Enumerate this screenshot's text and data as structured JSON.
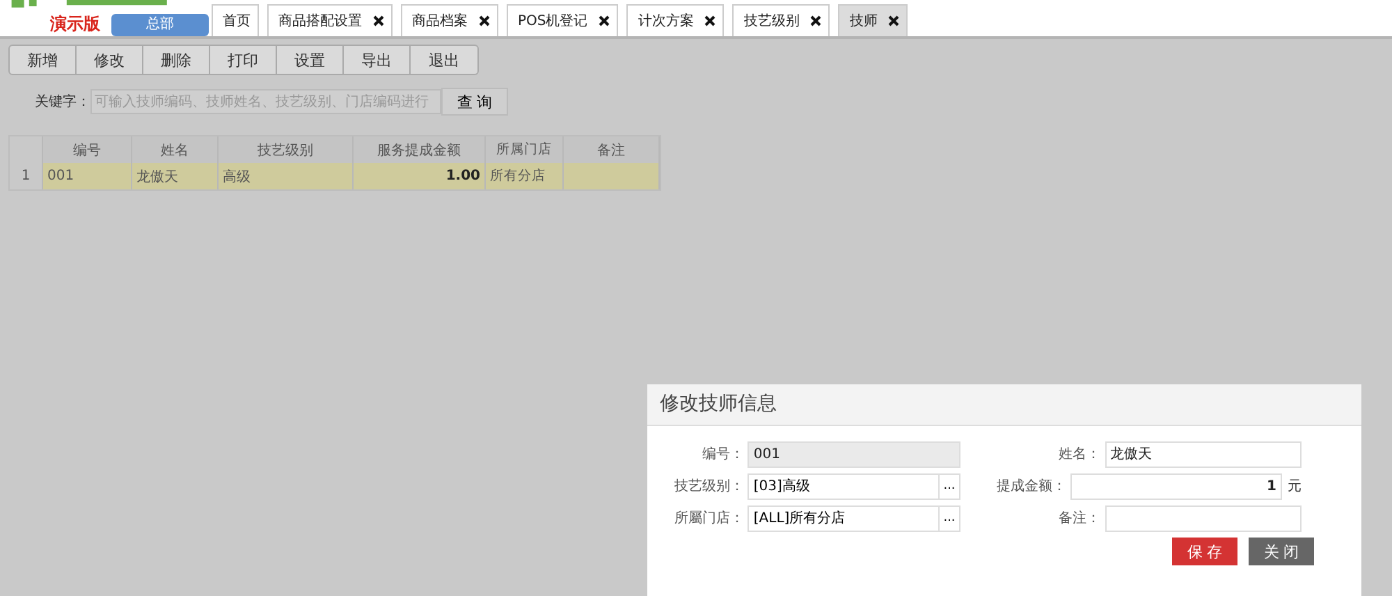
{
  "header": {
    "edition": "演示版",
    "branch": "总部"
  },
  "tabs": [
    {
      "label": "首页",
      "closable": false,
      "selected": false
    },
    {
      "label": "商品搭配设置",
      "closable": true,
      "selected": false
    },
    {
      "label": "商品档案",
      "closable": true,
      "selected": false
    },
    {
      "label": "POS机登记",
      "closable": true,
      "selected": false
    },
    {
      "label": "计次方案",
      "closable": true,
      "selected": false
    },
    {
      "label": "技艺级别",
      "closable": true,
      "selected": false
    },
    {
      "label": "技师",
      "closable": true,
      "selected": true
    }
  ],
  "toolbar": [
    "新增",
    "修改",
    "删除",
    "打印",
    "设置",
    "导出",
    "退出"
  ],
  "search": {
    "label": "关键字：",
    "placeholder": "可输入技师编码、技师姓名、技艺级别、门店编码进行",
    "button": "查 询"
  },
  "table": {
    "columns": [
      "编号",
      "姓名",
      "技艺级别",
      "服务提成金额",
      "所属门店",
      "备注"
    ],
    "rows": [
      {
        "index": "1",
        "selected": true,
        "cells": [
          "001",
          "龙傲天",
          "高级",
          "1.00",
          "所有分店",
          ""
        ]
      }
    ]
  },
  "dialog": {
    "title": "修改技师信息",
    "fields": [
      {
        "label": "编号：",
        "value": "001",
        "kind": "readonly"
      },
      {
        "label": "姓名：",
        "value": "龙傲天",
        "kind": "text"
      },
      {
        "label": "技艺级别：",
        "value": "[03]高级",
        "kind": "picker",
        "button": "..."
      },
      {
        "label": "提成金额：",
        "value": "1",
        "kind": "number",
        "unit": "元"
      },
      {
        "label": "所屬门店：",
        "value": "[ALL]所有分店",
        "kind": "picker",
        "button": "..."
      },
      {
        "label": "备注：",
        "kind": "text"
      }
    ],
    "buttons": [
      {
        "label": "保 存",
        "kind": "primary"
      },
      {
        "label": "关 闭",
        "kind": "secondary"
      }
    ]
  }
}
